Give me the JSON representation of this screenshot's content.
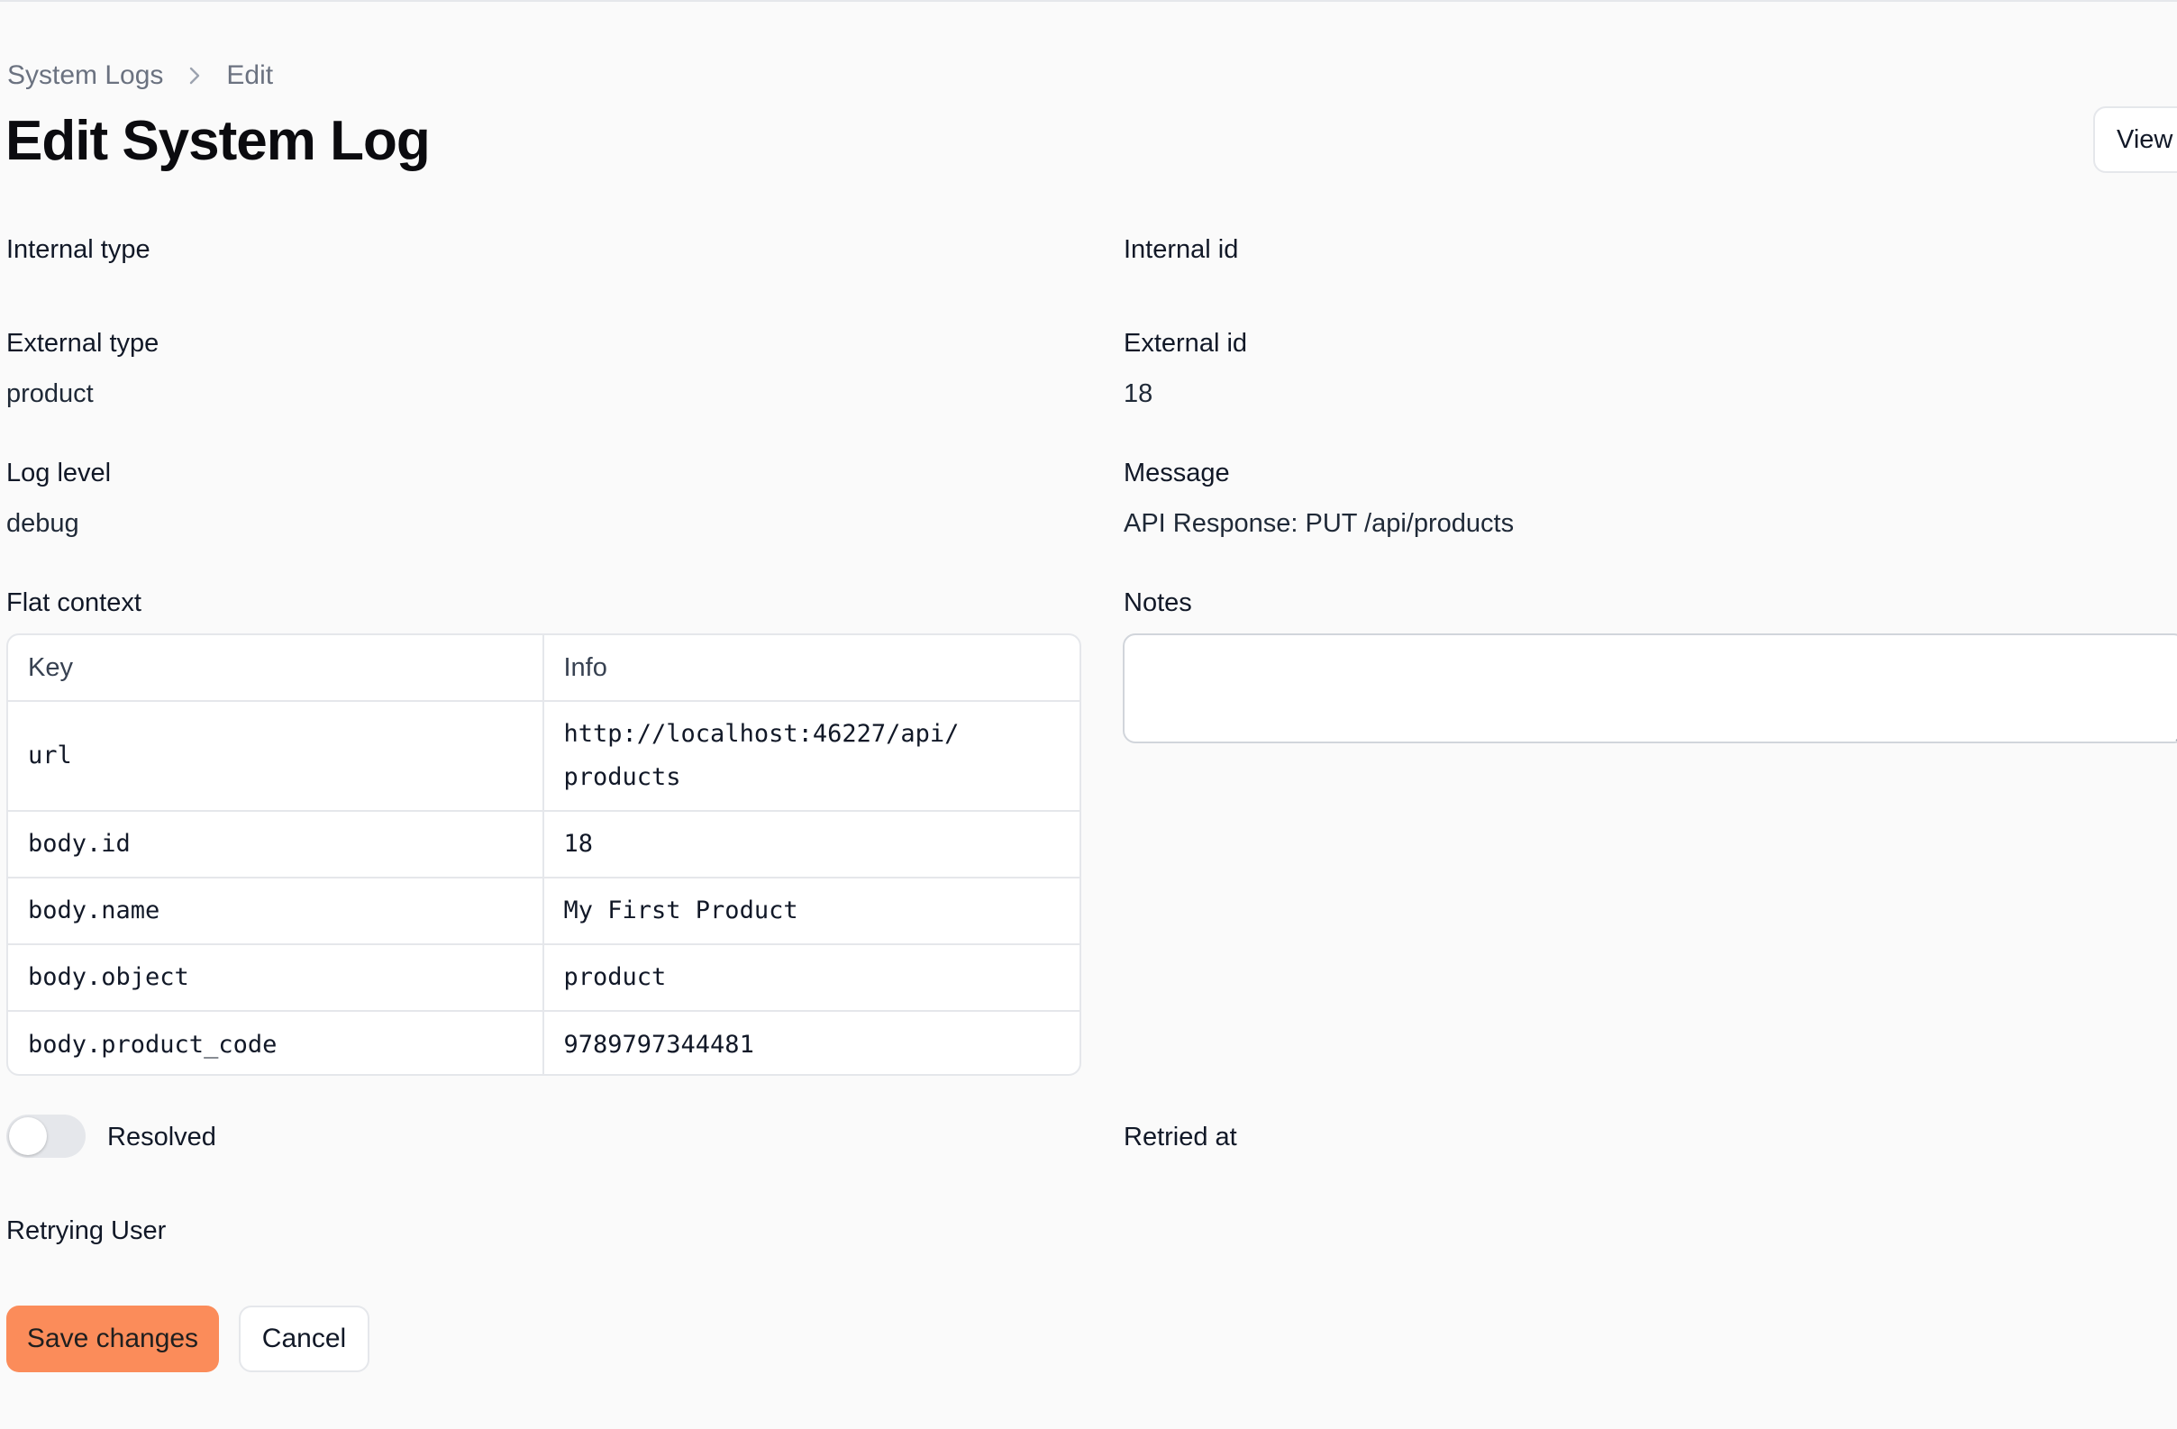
{
  "breadcrumb": {
    "parent": "System Logs",
    "current": "Edit"
  },
  "header": {
    "title": "Edit System Log",
    "view_button": "View"
  },
  "fields": {
    "internal_type": {
      "label": "Internal type",
      "value": ""
    },
    "internal_id": {
      "label": "Internal id",
      "value": ""
    },
    "external_type": {
      "label": "External type",
      "value": "product"
    },
    "external_id": {
      "label": "External id",
      "value": "18"
    },
    "log_level": {
      "label": "Log level",
      "value": "debug"
    },
    "message": {
      "label": "Message",
      "value": "API Response: PUT /api/products"
    },
    "flat_context": {
      "label": "Flat context"
    },
    "notes": {
      "label": "Notes",
      "value": ""
    },
    "resolved": {
      "label": "Resolved",
      "checked": false
    },
    "retried_at": {
      "label": "Retried at"
    },
    "retrying_user": {
      "label": "Retrying User"
    }
  },
  "context_table": {
    "headers": [
      "Key",
      "Info"
    ],
    "rows": [
      {
        "key": "url",
        "info": "http://localhost:46227/api/",
        "info2": "products"
      },
      {
        "key": "body.id",
        "info": "18"
      },
      {
        "key": "body.name",
        "info": "My First Product"
      },
      {
        "key": "body.object",
        "info": "product"
      },
      {
        "key": "body.product_code",
        "info": "9789797344481"
      }
    ]
  },
  "actions": {
    "save": "Save changes",
    "cancel": "Cancel"
  },
  "colors": {
    "accent": "#fb8c5a",
    "background": "#fafafa",
    "border": "#e5e7eb"
  }
}
